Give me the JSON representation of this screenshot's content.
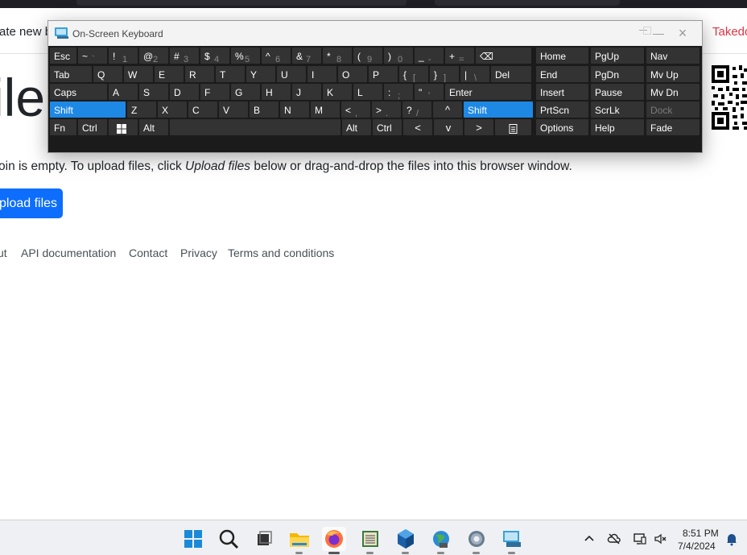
{
  "navbar": {
    "create_text": "ate new b",
    "takedown_text": "Takedo"
  },
  "page": {
    "title_fragment": "ile",
    "empty_message_start": "oin is empty. To upload files, click ",
    "empty_message_em": "Upload files",
    "empty_message_end": " below or drag-and-drop the files into this browser window.",
    "upload_button": "pload files"
  },
  "footer": {
    "links": [
      "ut",
      "API documentation",
      "Contact",
      "Privacy",
      "Terms and conditions"
    ]
  },
  "osk": {
    "title": "On-Screen Keyboard",
    "controls": [
      "minimize-icon",
      "maximize-icon",
      "close-icon"
    ],
    "rows": [
      [
        {
          "p": "Esc"
        },
        {
          "p": "~",
          "s": "`"
        },
        {
          "p": "!",
          "s": "1"
        },
        {
          "p": "@",
          "s": "2"
        },
        {
          "p": "#",
          "s": "3"
        },
        {
          "p": "$",
          "s": "4"
        },
        {
          "p": "%",
          "s": "5"
        },
        {
          "p": "^",
          "s": "6"
        },
        {
          "p": "&",
          "s": "7"
        },
        {
          "p": "*",
          "s": "8"
        },
        {
          "p": "(",
          "s": "9"
        },
        {
          "p": ")",
          "s": "0"
        },
        {
          "p": "_",
          "s": "-"
        },
        {
          "p": "+",
          "s": "="
        },
        {
          "p": "⌫"
        }
      ],
      [
        {
          "p": "Tab"
        },
        {
          "p": "Q"
        },
        {
          "p": "W"
        },
        {
          "p": "E"
        },
        {
          "p": "R"
        },
        {
          "p": "T"
        },
        {
          "p": "Y"
        },
        {
          "p": "U"
        },
        {
          "p": "I"
        },
        {
          "p": "O"
        },
        {
          "p": "P"
        },
        {
          "p": "{",
          "s": "["
        },
        {
          "p": "}",
          "s": "]"
        },
        {
          "p": "|",
          "s": "\\"
        },
        {
          "p": "Del"
        }
      ],
      [
        {
          "p": "Caps"
        },
        {
          "p": "A"
        },
        {
          "p": "S"
        },
        {
          "p": "D"
        },
        {
          "p": "F"
        },
        {
          "p": "G"
        },
        {
          "p": "H"
        },
        {
          "p": "J"
        },
        {
          "p": "K"
        },
        {
          "p": "L"
        },
        {
          "p": ":",
          "s": ";"
        },
        {
          "p": "\"",
          "s": "'"
        },
        {
          "p": "Enter"
        }
      ],
      [
        {
          "p": "Shift"
        },
        {
          "p": "Z"
        },
        {
          "p": "X"
        },
        {
          "p": "C"
        },
        {
          "p": "V"
        },
        {
          "p": "B"
        },
        {
          "p": "N"
        },
        {
          "p": "M"
        },
        {
          "p": "<",
          "s": ","
        },
        {
          "p": ">",
          "s": "."
        },
        {
          "p": "?",
          "s": "/"
        },
        {
          "p": "^"
        },
        {
          "p": "Shift"
        }
      ],
      [
        {
          "p": "Fn"
        },
        {
          "p": "Ctrl"
        },
        {
          "p": "windows-icon"
        },
        {
          "p": "Alt"
        },
        {
          "p": ""
        },
        {
          "p": "Alt"
        },
        {
          "p": "Ctrl"
        },
        {
          "p": "<"
        },
        {
          "p": "v"
        },
        {
          "p": ">"
        },
        {
          "p": "menu-icon"
        }
      ]
    ],
    "nav_keys": [
      [
        "Home",
        "PgUp",
        "Nav"
      ],
      [
        "End",
        "PgDn",
        "Mv Up"
      ],
      [
        "Insert",
        "Pause",
        "Mv Dn"
      ],
      [
        "PrtScn",
        "ScrLk",
        "Dock"
      ],
      [
        "Options",
        "Help",
        "Fade"
      ]
    ]
  },
  "taskbar": {
    "apps": [
      "windows-start-icon",
      "search-icon",
      "task-view-icon",
      "file-explorer-icon",
      "firefox-icon",
      "app-icon",
      "virtualbox-icon",
      "network-globe-icon",
      "settings-icon",
      "on-screen-keyboard-icon"
    ],
    "tray": [
      "chevron-up-icon",
      "cloud-offline-icon",
      "display-icon",
      "speaker-muted-icon",
      "notification-bell-icon"
    ],
    "time": "8:51 PM",
    "date": "7/4/2024"
  },
  "colors": {
    "accent_blue": "#0d6efd",
    "takedown_red": "#dc3545",
    "osk_active_key": "#1e88e5",
    "osk_key": "#333333"
  }
}
